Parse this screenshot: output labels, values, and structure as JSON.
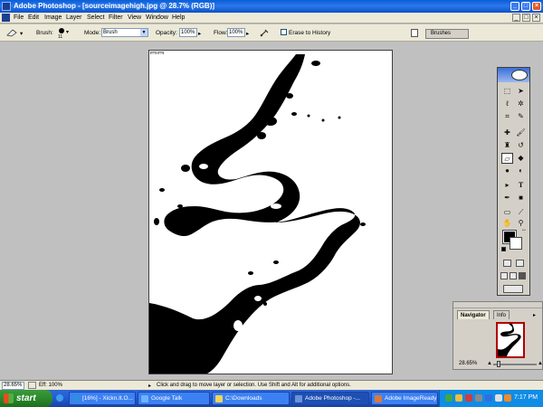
{
  "window": {
    "title": "Adobe Photoshop - [sourceimagehigh.jpg @ 28.7% (RGB)]",
    "controls": {
      "minimize": "_",
      "maximize": "□",
      "close": "×"
    }
  },
  "menu": {
    "items": [
      "File",
      "Edit",
      "Image",
      "Layer",
      "Select",
      "Filter",
      "View",
      "Window",
      "Help"
    ],
    "doc_controls": {
      "minimize": "_",
      "restore": "□",
      "close": "×"
    }
  },
  "options_bar": {
    "tool_icon": "eraser-icon",
    "brush_label": "Brush:",
    "brush_size": "11",
    "mode_label": "Mode:",
    "mode_value": "Brush",
    "opacity_label": "Opacity:",
    "opacity_value": "100%",
    "flow_label": "Flow:",
    "flow_value": "100%",
    "airbrush_icon": "airbrush-icon",
    "erase_history_label": "Erase to History",
    "erase_history_checked": false,
    "palette_well_tab": "Brushes"
  },
  "toolbox": {
    "tools": [
      "marquee-icon",
      "move-icon",
      "lasso-icon",
      "magic-wand-icon",
      "crop-icon",
      "slice-icon",
      "healing-brush-icon",
      "brush-icon",
      "clone-stamp-icon",
      "history-brush-icon",
      "eraser-icon",
      "paint-bucket-icon",
      "blur-icon",
      "dodge-icon",
      "path-selection-icon",
      "type-icon",
      "pen-icon",
      "shape-icon",
      "notes-icon",
      "eyedropper-icon",
      "hand-icon",
      "zoom-icon"
    ],
    "type_tool_glyph": "T",
    "foreground_color": "#000000",
    "background_color": "#ffffff"
  },
  "navigator": {
    "tabs": [
      "Navigator",
      "Info"
    ],
    "active_tab": "Navigator",
    "zoom": "28.65%",
    "zoom_slider_fraction": 0.1
  },
  "status": {
    "zoom": "28.65%",
    "doc_info": "Eff: 100%",
    "message": "Click and drag to move layer or selection. Use Shift and Alt for additional options."
  },
  "taskbar": {
    "start_label": "start",
    "tasks": [
      {
        "label": "[16%] - Xickn.It.O...",
        "icon": "browser-icon",
        "active": false
      },
      {
        "label": "Google Talk",
        "icon": "chat-icon",
        "active": false
      },
      {
        "label": "C:\\Downloads",
        "icon": "folder-icon",
        "active": false
      },
      {
        "label": "Adobe Photoshop -...",
        "icon": "photoshop-icon",
        "active": true
      },
      {
        "label": "Adobe ImageReady",
        "icon": "imageready-icon",
        "active": false
      }
    ],
    "clock": "7:17 PM"
  },
  "colors": {
    "titlebar": "#0a5ed8",
    "taskbar": "#245edb",
    "start_button": "#2c8a2c",
    "workspace": "#c0c0c0"
  }
}
